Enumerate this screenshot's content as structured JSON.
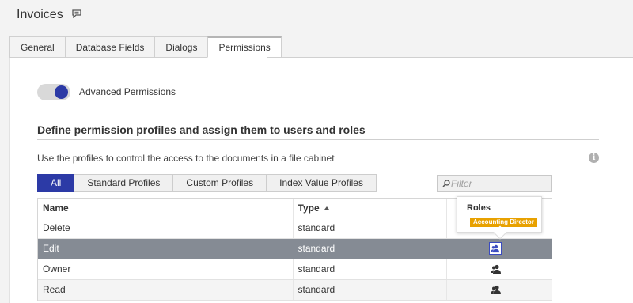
{
  "window": {
    "title": "Invoices"
  },
  "tabs": [
    "General",
    "Database Fields",
    "Dialogs",
    "Permissions"
  ],
  "active_tab": "Permissions",
  "advanced": {
    "label": "Advanced Permissions",
    "enabled": true
  },
  "section": {
    "title": "Define permission profiles and assign them to users and roles",
    "description": "Use the profiles to control the access to the documents in a file cabinet"
  },
  "filters": {
    "items": [
      "All",
      "Standard Profiles",
      "Custom Profiles",
      "Index Value Profiles"
    ],
    "active": "All"
  },
  "search": {
    "placeholder": "Filter"
  },
  "table": {
    "columns": [
      "Name",
      "Type"
    ],
    "rows": [
      {
        "name": "Delete",
        "type": "standard"
      },
      {
        "name": "Edit",
        "type": "standard"
      },
      {
        "name": "Owner",
        "type": "standard"
      },
      {
        "name": "Read",
        "type": "standard"
      }
    ],
    "selected_row": "Edit"
  },
  "tooltip": {
    "title": "Roles",
    "badge": "Accounting Director"
  },
  "colors": {
    "accent": "#2c3aa6",
    "selected_row": "#858b94",
    "badge": "#e8a100"
  },
  "icons": [
    "comment-icon",
    "info-icon",
    "search-icon",
    "user-icon"
  ]
}
